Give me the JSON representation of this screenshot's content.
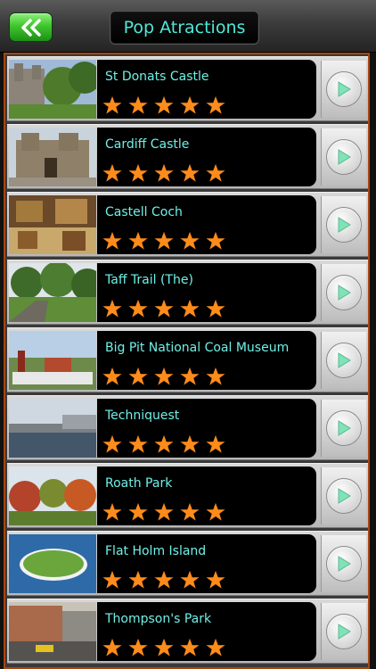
{
  "header": {
    "title": "Pop Atractions",
    "back_icon": "double-chevron-left-icon",
    "accent_color": "#4fe8d8"
  },
  "attractions": [
    {
      "name": "St Donats Castle",
      "rating": 5
    },
    {
      "name": "Cardiff Castle",
      "rating": 5
    },
    {
      "name": "Castell Coch",
      "rating": 5
    },
    {
      "name": "Taff Trail (The)",
      "rating": 5
    },
    {
      "name": "Big Pit National Coal Museum",
      "rating": 5
    },
    {
      "name": "Techniquest",
      "rating": 5
    },
    {
      "name": "Roath Park",
      "rating": 5
    },
    {
      "name": "Flat Holm Island",
      "rating": 5
    },
    {
      "name": "Thompson's Park",
      "rating": 5
    }
  ],
  "icons": {
    "star": "star-icon",
    "go": "play-arrow-icon"
  },
  "colors": {
    "star": "#ff8c1a",
    "frame": "#a84610",
    "go_arrow": "#7fe3b7"
  }
}
